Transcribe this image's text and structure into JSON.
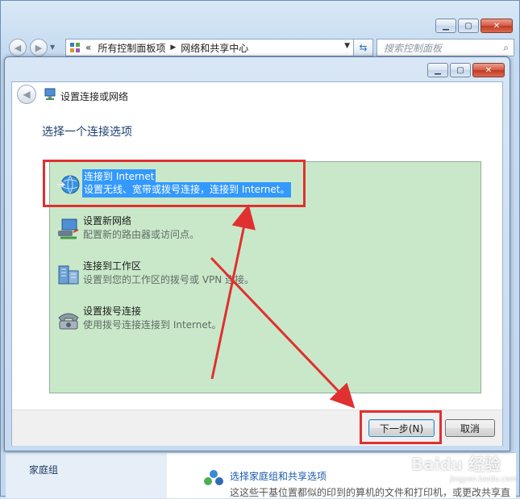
{
  "background_window": {
    "breadcrumb_root": "所有控制面板项",
    "breadcrumb_current": "网络和共享中心",
    "breadcrumb_prefix": "«",
    "search_placeholder": "搜索控制面板",
    "homegroup_label": "家庭组",
    "homegroup_link": "选择家庭组和共享选项",
    "homegroup_desc": "这这些干基位置都似的印到的算机的文件和打印机，或更改共享直",
    "caption_buttons": [
      "minimize-icon",
      "maximize-icon",
      "close-icon"
    ]
  },
  "dialog": {
    "title": "设置连接或网络",
    "heading": "选择一个连接选项",
    "options": [
      {
        "title": "连接到 Internet",
        "desc": "设置无线、宽带或拨号连接，连接到 Internet。",
        "icon": "globe-icon",
        "selected": true
      },
      {
        "title": "设置新网络",
        "desc": "配置新的路由器或访问点。",
        "icon": "router-icon",
        "selected": false
      },
      {
        "title": "连接到工作区",
        "desc": "设置到您的工作区的拨号或 VPN 连接。",
        "icon": "workplace-icon",
        "selected": false
      },
      {
        "title": "设置拨号连接",
        "desc": "使用拨号连接连接到 Internet。",
        "icon": "dialup-phone-icon",
        "selected": false
      }
    ],
    "next_label": "下一步(N)",
    "cancel_label": "取消"
  },
  "watermark": {
    "text": "Baidu 经验",
    "sub": "jingyan.baidu.com"
  },
  "colors": {
    "listbox_bg": "#c9e8c9",
    "selection": "#3399ff",
    "annotation_red": "#e03030"
  }
}
